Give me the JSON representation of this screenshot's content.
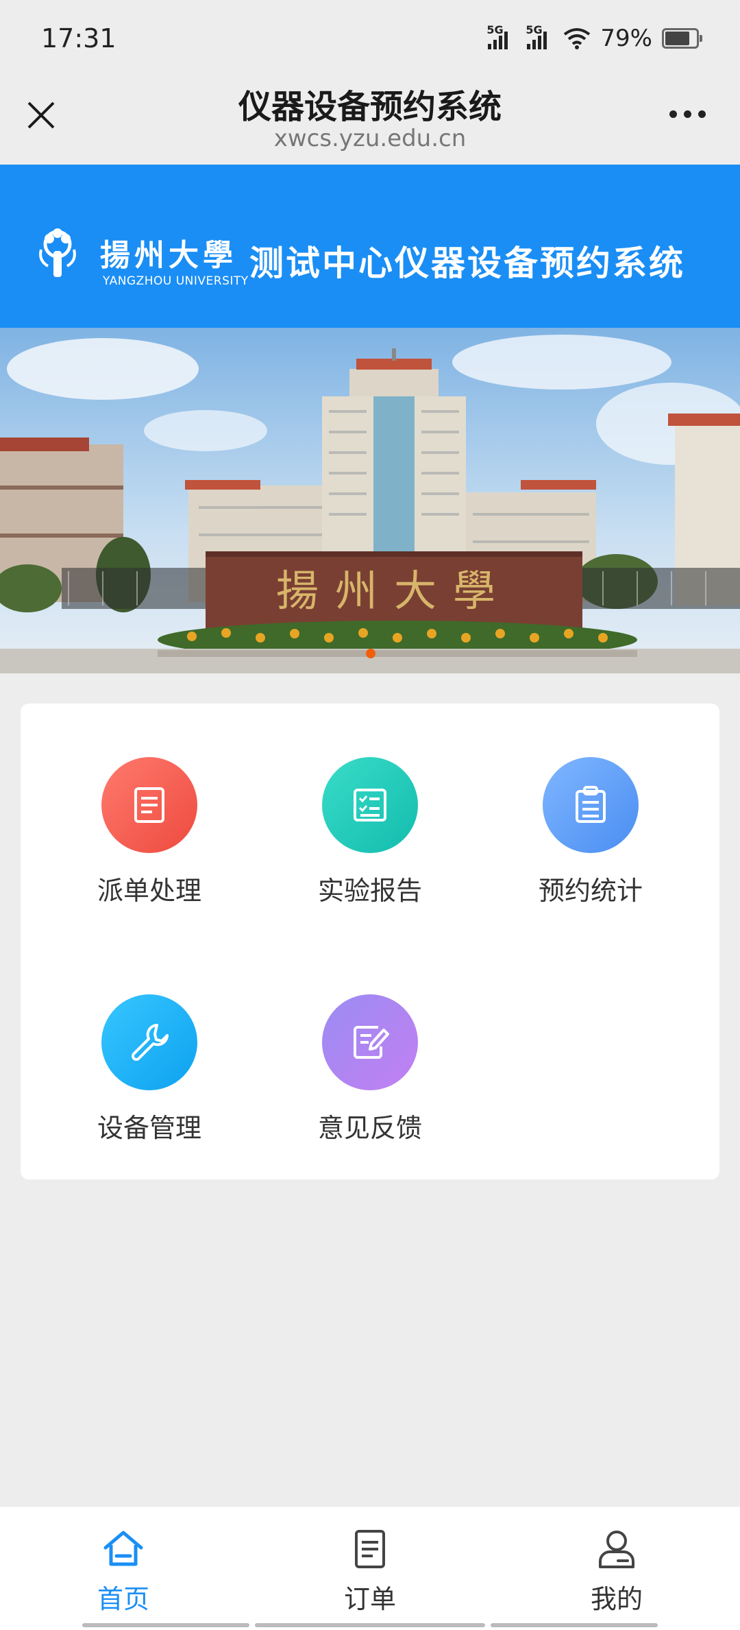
{
  "status_bar": {
    "time": "17:31",
    "signal1": "5G",
    "signal2": "5G",
    "battery": "79%"
  },
  "title_bar": {
    "title": "仪器设备预约系统",
    "url": "xwcs.yzu.edu.cn"
  },
  "banner": {
    "university_cn": "揚州大學",
    "university_en": "YANGZHOU UNIVERSITY",
    "system_name": "测试中心仪器设备预约系统",
    "photo_sign": "揚州大學"
  },
  "menu": [
    {
      "label": "派单处理",
      "icon": "document-icon",
      "color": "#f2554a"
    },
    {
      "label": "实验报告",
      "icon": "checklist-icon",
      "color": "#1fcab9"
    },
    {
      "label": "预约统计",
      "icon": "clipboard-icon",
      "color": "#5a9cf7"
    },
    {
      "label": "设备管理",
      "icon": "wrench-icon",
      "color": "#1aaef5"
    },
    {
      "label": "意见反馈",
      "icon": "edit-note-icon",
      "color": "#b07ff0"
    }
  ],
  "bottom_nav": [
    {
      "label": "首页",
      "icon": "home-icon",
      "active": true
    },
    {
      "label": "订单",
      "icon": "order-icon",
      "active": false
    },
    {
      "label": "我的",
      "icon": "user-icon",
      "active": false
    }
  ],
  "colors": {
    "accent": "#1a8ef5",
    "background": "#ededed"
  }
}
